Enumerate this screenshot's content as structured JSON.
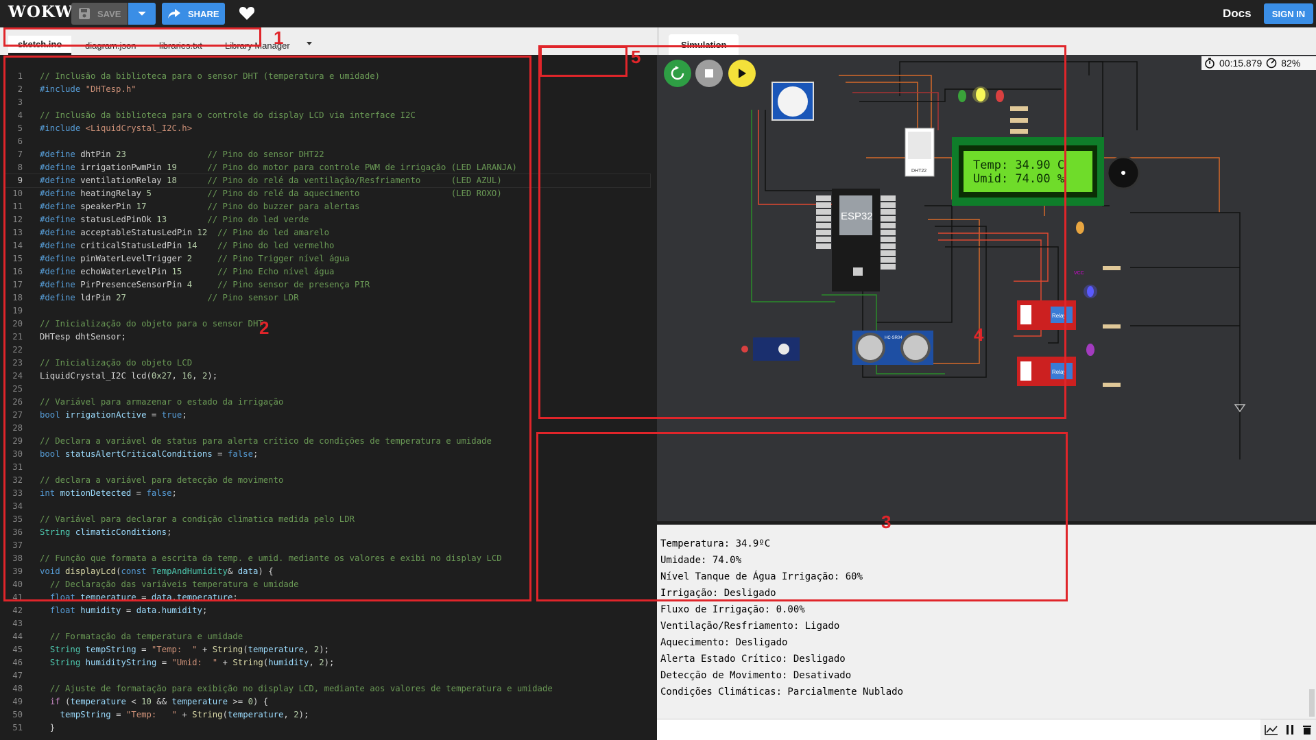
{
  "topbar": {
    "logo": "WOKWi",
    "save_label": "SAVE",
    "share_label": "SHARE",
    "docs_label": "Docs",
    "signin_label": "SIGN IN",
    "accent": "#3a8ee6"
  },
  "editor_tabs": [
    "sketch.ino",
    "diagram.json",
    "libraries.txt",
    "Library Manager"
  ],
  "sim_tab": "Simulation",
  "timer": {
    "time": "00:15.879",
    "speed": "82%"
  },
  "code_lines": [
    [
      [
        "com",
        "// Inclusão da biblioteca para o sensor DHT (temperatura e umidade)"
      ]
    ],
    [
      [
        "pp",
        "#include "
      ],
      [
        "str",
        "\"DHTesp.h\""
      ]
    ],
    [],
    [
      [
        "com",
        "// Inclusão da biblioteca para o controle do display LCD via interface I2C"
      ]
    ],
    [
      [
        "pp",
        "#include "
      ],
      [
        "str",
        "<LiquidCrystal_I2C.h>"
      ]
    ],
    [],
    [
      [
        "pp",
        "#define "
      ],
      [
        "txt",
        "dhtPin "
      ],
      [
        "num",
        "23"
      ],
      [
        "txt",
        "                "
      ],
      [
        "com",
        "// Pino do sensor DHT22"
      ]
    ],
    [
      [
        "pp",
        "#define "
      ],
      [
        "txt",
        "irrigationPwmPin "
      ],
      [
        "num",
        "19"
      ],
      [
        "txt",
        "      "
      ],
      [
        "com",
        "// Pino do motor para controle PWM de irrigação (LED LARANJA)"
      ]
    ],
    [
      [
        "pp",
        "#define "
      ],
      [
        "txt",
        "ventilationRelay "
      ],
      [
        "num",
        "18"
      ],
      [
        "txt",
        "      "
      ],
      [
        "com",
        "// Pino do relé da ventilação/Resfriamento      (LED AZUL)"
      ]
    ],
    [
      [
        "pp",
        "#define "
      ],
      [
        "txt",
        "heatingRelay "
      ],
      [
        "num",
        "5"
      ],
      [
        "txt",
        "           "
      ],
      [
        "com",
        "// Pino do relé da aquecimento                  (LED ROXO)"
      ]
    ],
    [
      [
        "pp",
        "#define "
      ],
      [
        "txt",
        "speakerPin "
      ],
      [
        "num",
        "17"
      ],
      [
        "txt",
        "            "
      ],
      [
        "com",
        "// Pino do buzzer para alertas"
      ]
    ],
    [
      [
        "pp",
        "#define "
      ],
      [
        "txt",
        "statusLedPinOk "
      ],
      [
        "num",
        "13"
      ],
      [
        "txt",
        "        "
      ],
      [
        "com",
        "// Pino do led verde"
      ]
    ],
    [
      [
        "pp",
        "#define "
      ],
      [
        "txt",
        "acceptableStatusLedPin "
      ],
      [
        "num",
        "12"
      ],
      [
        "txt",
        "  "
      ],
      [
        "com",
        "// Pino do led amarelo"
      ]
    ],
    [
      [
        "pp",
        "#define "
      ],
      [
        "txt",
        "criticalStatusLedPin "
      ],
      [
        "num",
        "14"
      ],
      [
        "txt",
        "    "
      ],
      [
        "com",
        "// Pino do led vermelho"
      ]
    ],
    [
      [
        "pp",
        "#define "
      ],
      [
        "txt",
        "pinWaterLevelTrigger "
      ],
      [
        "num",
        "2"
      ],
      [
        "txt",
        "     "
      ],
      [
        "com",
        "// Pino Trigger nível água"
      ]
    ],
    [
      [
        "pp",
        "#define "
      ],
      [
        "txt",
        "echoWaterLevelPin "
      ],
      [
        "num",
        "15"
      ],
      [
        "txt",
        "       "
      ],
      [
        "com",
        "// Pino Echo nível água"
      ]
    ],
    [
      [
        "pp",
        "#define "
      ],
      [
        "txt",
        "PirPresenceSensorPin "
      ],
      [
        "num",
        "4"
      ],
      [
        "txt",
        "     "
      ],
      [
        "com",
        "// Pino sensor de presença PIR"
      ]
    ],
    [
      [
        "pp",
        "#define "
      ],
      [
        "txt",
        "ldrPin "
      ],
      [
        "num",
        "27"
      ],
      [
        "txt",
        "                "
      ],
      [
        "com",
        "// Pino sensor LDR"
      ]
    ],
    [],
    [
      [
        "com",
        "// Inicialização do objeto para o sensor DHT"
      ]
    ],
    [
      [
        "txt",
        "DHTesp dhtSensor;"
      ]
    ],
    [],
    [
      [
        "com",
        "// Inicialização do objeto LCD"
      ]
    ],
    [
      [
        "txt",
        "LiquidCrystal_I2C lcd("
      ],
      [
        "num",
        "0x27"
      ],
      [
        "txt",
        ", "
      ],
      [
        "num",
        "16"
      ],
      [
        "txt",
        ", "
      ],
      [
        "num",
        "2"
      ],
      [
        "txt",
        ");"
      ]
    ],
    [],
    [
      [
        "com",
        "// Variável para armazenar o estado da irrigação"
      ]
    ],
    [
      [
        "kw",
        "bool "
      ],
      [
        "var",
        "irrigationActive"
      ],
      [
        "txt",
        " = "
      ],
      [
        "kw",
        "true"
      ],
      [
        "txt",
        ";"
      ]
    ],
    [],
    [
      [
        "com",
        "// Declara a variável de status para alerta crítico de condições de temperatura e umidade"
      ]
    ],
    [
      [
        "kw",
        "bool "
      ],
      [
        "var",
        "statusAlertCriticalConditions"
      ],
      [
        "txt",
        " = "
      ],
      [
        "kw",
        "false"
      ],
      [
        "txt",
        ";"
      ]
    ],
    [],
    [
      [
        "com",
        "// declara a variável para detecção de movimento"
      ]
    ],
    [
      [
        "kw",
        "int "
      ],
      [
        "var",
        "motionDetected"
      ],
      [
        "txt",
        " = "
      ],
      [
        "kw",
        "false"
      ],
      [
        "txt",
        ";"
      ]
    ],
    [],
    [
      [
        "com",
        "// Variável para declarar a condição climatica medida pelo LDR"
      ]
    ],
    [
      [
        "ty",
        "String "
      ],
      [
        "var",
        "climaticConditions"
      ],
      [
        "txt",
        ";"
      ]
    ],
    [],
    [
      [
        "com",
        "// Função que formata a escrita da temp. e umid. mediante os valores e exibi no display LCD"
      ]
    ],
    [
      [
        "kw",
        "void "
      ],
      [
        "fn",
        "displayLcd"
      ],
      [
        "txt",
        "("
      ],
      [
        "kw",
        "const "
      ],
      [
        "ty",
        "TempAndHumidity"
      ],
      [
        "txt",
        "& "
      ],
      [
        "var",
        "data"
      ],
      [
        "txt",
        ") {"
      ]
    ],
    [
      [
        "txt",
        "  "
      ],
      [
        "com",
        "// Declaração das variáveis temperatura e umidade"
      ]
    ],
    [
      [
        "txt",
        "  "
      ],
      [
        "kw",
        "float "
      ],
      [
        "var",
        "temperature"
      ],
      [
        "txt",
        " = "
      ],
      [
        "var",
        "data"
      ],
      [
        "txt",
        "."
      ],
      [
        "var",
        "temperature"
      ],
      [
        "txt",
        ";"
      ]
    ],
    [
      [
        "txt",
        "  "
      ],
      [
        "kw",
        "float "
      ],
      [
        "var",
        "humidity"
      ],
      [
        "txt",
        " = "
      ],
      [
        "var",
        "data"
      ],
      [
        "txt",
        "."
      ],
      [
        "var",
        "humidity"
      ],
      [
        "txt",
        ";"
      ]
    ],
    [],
    [
      [
        "txt",
        "  "
      ],
      [
        "com",
        "// Formatação da temperatura e umidade"
      ]
    ],
    [
      [
        "txt",
        "  "
      ],
      [
        "ty",
        "String "
      ],
      [
        "var",
        "tempString"
      ],
      [
        "txt",
        " = "
      ],
      [
        "str",
        "\"Temp:  \""
      ],
      [
        "txt",
        " + "
      ],
      [
        "fn",
        "String"
      ],
      [
        "txt",
        "("
      ],
      [
        "var",
        "temperature"
      ],
      [
        "txt",
        ", "
      ],
      [
        "num",
        "2"
      ],
      [
        "txt",
        ");"
      ]
    ],
    [
      [
        "txt",
        "  "
      ],
      [
        "ty",
        "String "
      ],
      [
        "var",
        "humidityString"
      ],
      [
        "txt",
        " = "
      ],
      [
        "str",
        "\"Umid:  \""
      ],
      [
        "txt",
        " + "
      ],
      [
        "fn",
        "String"
      ],
      [
        "txt",
        "("
      ],
      [
        "var",
        "humidity"
      ],
      [
        "txt",
        ", "
      ],
      [
        "num",
        "2"
      ],
      [
        "txt",
        ");"
      ]
    ],
    [],
    [
      [
        "txt",
        "  "
      ],
      [
        "com",
        "// Ajuste de formatação para exibição no display LCD, mediante aos valores de temperatura e umidade"
      ]
    ],
    [
      [
        "txt",
        "  "
      ],
      [
        "ctl",
        "if"
      ],
      [
        "txt",
        " ("
      ],
      [
        "var",
        "temperature"
      ],
      [
        "txt",
        " < "
      ],
      [
        "num",
        "10"
      ],
      [
        "txt",
        " && "
      ],
      [
        "var",
        "temperature"
      ],
      [
        "txt",
        " >= "
      ],
      [
        "num",
        "0"
      ],
      [
        "txt",
        ") {"
      ]
    ],
    [
      [
        "txt",
        "    "
      ],
      [
        "var",
        "tempString"
      ],
      [
        "txt",
        " = "
      ],
      [
        "str",
        "\"Temp:   \""
      ],
      [
        "txt",
        " + "
      ],
      [
        "fn",
        "String"
      ],
      [
        "txt",
        "("
      ],
      [
        "var",
        "temperature"
      ],
      [
        "txt",
        ", "
      ],
      [
        "num",
        "2"
      ],
      [
        "txt",
        ");"
      ]
    ],
    [
      [
        "txt",
        "  }"
      ]
    ]
  ],
  "serial_lines": [
    "Temperatura: 34.9ºC",
    "Umidade: 74.0%",
    "Nível Tanque de Água Irrigação: 60%",
    "Irrigação: Desligado",
    "Fluxo de Irrigação: 0.00%",
    "Ventilação/Resfriamento: Ligado",
    "Aquecimento: Desligado",
    "Alerta Estado Crítico: Desligado",
    "Detecção de Movimento: Desativado",
    "Condições Climáticas: Parcialmente Nublado"
  ],
  "lcd": {
    "line1": "Temp:  34.90 C",
    "line2": "Umid:  74.00 %"
  },
  "chip_labels": {
    "esp32": "ESP32",
    "dht": "DHT22",
    "relay": "Relay",
    "vcc": "VCC",
    "sonar": "HC-SR04"
  },
  "annotations": [
    "1",
    "2",
    "3",
    "4",
    "5"
  ],
  "annotation_color": "#e0252a"
}
